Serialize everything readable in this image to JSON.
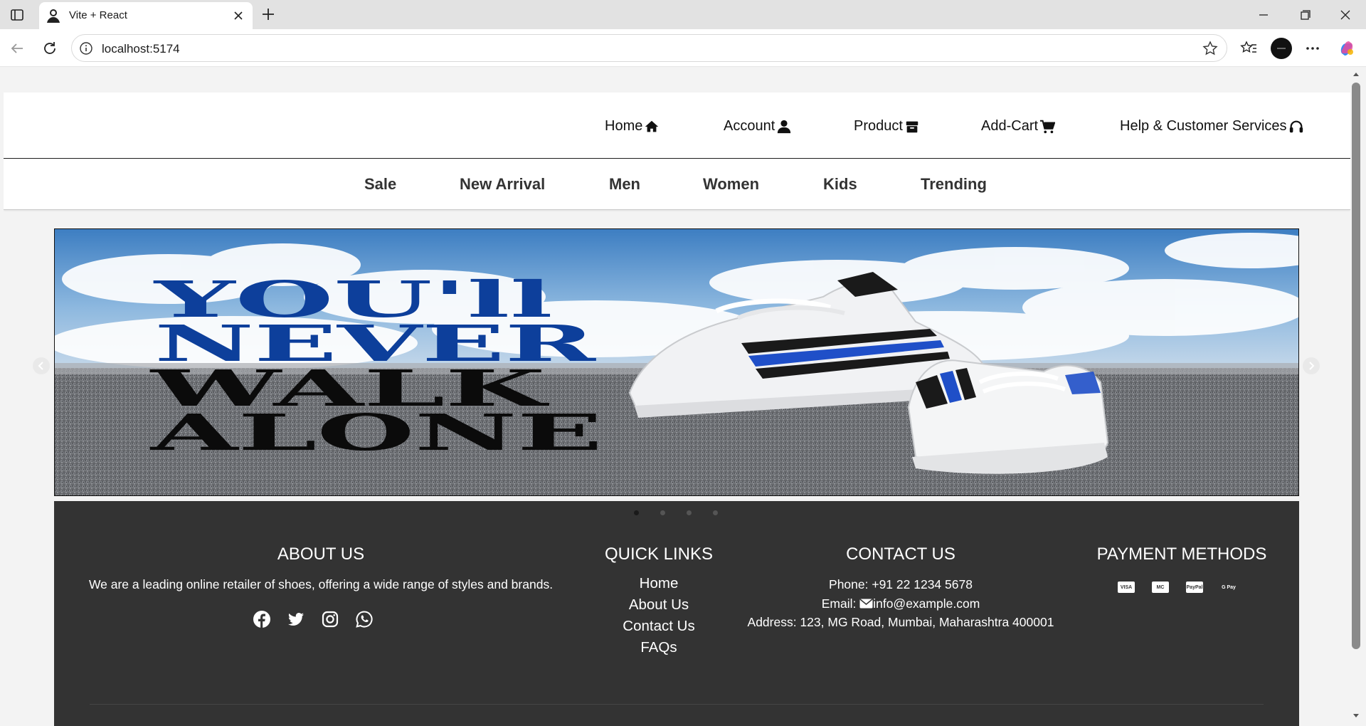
{
  "browser": {
    "tab_title": "Vite + React",
    "url": "localhost:5174"
  },
  "topnav": {
    "items": [
      {
        "label": "Home",
        "icon": "home-icon"
      },
      {
        "label": "Account",
        "icon": "user-icon"
      },
      {
        "label": "Product",
        "icon": "box-icon"
      },
      {
        "label": "Add-Cart",
        "icon": "cart-icon"
      },
      {
        "label": "Help & Customer Services",
        "icon": "headset-icon"
      }
    ]
  },
  "categories": [
    "Sale",
    "New Arrival",
    "Men",
    "Women",
    "Kids",
    "Trending"
  ],
  "hero": {
    "slogan": [
      "YOU'll",
      "NEVER",
      "WALK",
      "ALONE"
    ],
    "slide_count": 4,
    "active_slide": 1
  },
  "footer": {
    "about": {
      "heading": "ABOUT US",
      "text": "We are a leading online retailer of shoes, offering a wide range of styles and brands.",
      "social": [
        "facebook-icon",
        "twitter-icon",
        "instagram-icon",
        "whatsapp-icon"
      ]
    },
    "quick_links": {
      "heading": "QUICK LINKS",
      "links": [
        "Home",
        "About Us",
        "Contact Us",
        "FAQs"
      ]
    },
    "contact": {
      "heading": "CONTACT US",
      "phone": "Phone: +91 22 1234 5678",
      "email_label": "Email:",
      "email": "info@example.com",
      "address": "Address: 123, MG Road, Mumbai, Maharashtra 400001"
    },
    "payment": {
      "heading": "PAYMENT METHODS",
      "methods": [
        "VISA",
        "MC",
        "PayPal",
        "G Pay"
      ]
    }
  },
  "colors": {
    "footer_bg": "#333333",
    "slogan_blue": "#0d3f9b",
    "slogan_black": "#0b0b0b"
  }
}
